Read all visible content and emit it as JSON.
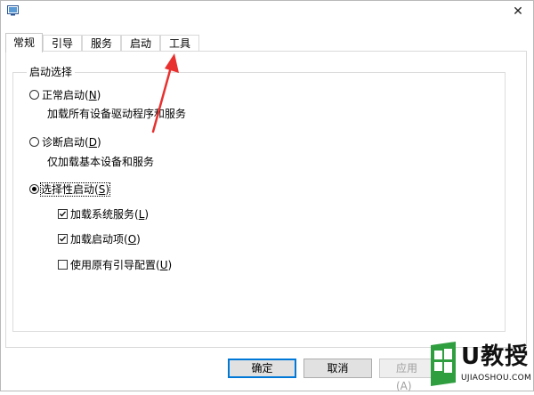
{
  "window": {
    "icon": "msconfig-app-icon",
    "close_glyph": "✕"
  },
  "tabs": [
    {
      "label": "常规",
      "active": true
    },
    {
      "label": "引导",
      "active": false
    },
    {
      "label": "服务",
      "active": false
    },
    {
      "label": "启动",
      "active": false
    },
    {
      "label": "工具",
      "active": false
    }
  ],
  "startup_selection": {
    "group_title": "启动选择",
    "options": [
      {
        "label": "正常启动(",
        "mnemonic": "N",
        "suffix": ")",
        "description": "加载所有设备驱动程序和服务",
        "selected": false
      },
      {
        "label": "诊断启动(",
        "mnemonic": "D",
        "suffix": ")",
        "description": "仅加载基本设备和服务",
        "selected": false
      },
      {
        "label": "选择性启动(",
        "mnemonic": "S",
        "suffix": ")",
        "description": "",
        "selected": true
      }
    ],
    "selective_items": [
      {
        "label": "加载系统服务(",
        "mnemonic": "L",
        "suffix": ")",
        "checked": true
      },
      {
        "label": "加载启动项(",
        "mnemonic": "O",
        "suffix": ")",
        "checked": true
      },
      {
        "label": "使用原有引导配置(",
        "mnemonic": "U",
        "suffix": ")",
        "checked": false
      }
    ]
  },
  "buttons": {
    "ok": "确定",
    "cancel": "取消",
    "apply": "应用(A)"
  },
  "annotation": {
    "arrow_color": "#e8312f"
  },
  "watermark": {
    "main_text": "U教授",
    "sub_text": "UJIAOSHOU.COM",
    "green": "#2f9e3f"
  }
}
